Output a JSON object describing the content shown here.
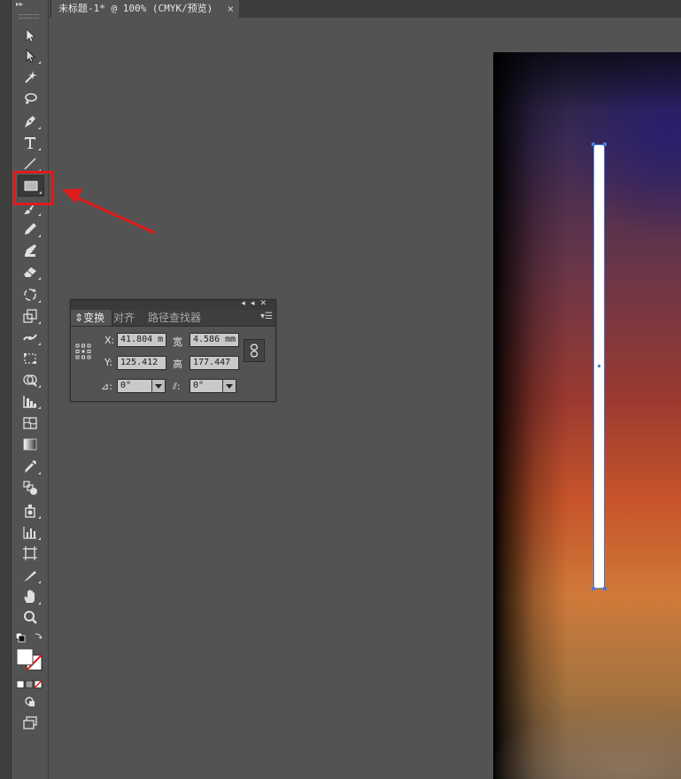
{
  "document_tab": {
    "title": "未标题-1* @ 100% (CMYK/预览)",
    "close": "×"
  },
  "toolbar": {
    "tools": [
      {
        "name": "selection-tool",
        "icon": "arrow-icon"
      },
      {
        "name": "direct-selection-tool",
        "icon": "white-arrow-icon"
      },
      {
        "name": "magic-wand-tool",
        "icon": "magic-wand-icon"
      },
      {
        "name": "lasso-tool",
        "icon": "lasso-icon"
      },
      {
        "name": "pen-tool",
        "icon": "pen-icon"
      },
      {
        "name": "type-tool",
        "icon": "type-icon",
        "label": "T"
      },
      {
        "name": "line-tool",
        "icon": "line-icon"
      },
      {
        "name": "rectangle-tool",
        "icon": "rectangle-icon"
      },
      {
        "name": "paintbrush-tool",
        "icon": "brush-icon"
      },
      {
        "name": "pencil-tool",
        "icon": "pencil-icon"
      },
      {
        "name": "blob-brush-tool",
        "icon": "blob-brush-icon"
      },
      {
        "name": "eraser-tool",
        "icon": "eraser-icon"
      },
      {
        "name": "rotate-tool",
        "icon": "rotate-icon"
      },
      {
        "name": "scale-tool",
        "icon": "scale-icon"
      },
      {
        "name": "width-tool",
        "icon": "width-icon"
      },
      {
        "name": "free-transform-tool",
        "icon": "free-transform-icon"
      },
      {
        "name": "shape-builder-tool",
        "icon": "shape-builder-icon"
      },
      {
        "name": "perspective-grid-tool",
        "icon": "perspective-grid-icon"
      },
      {
        "name": "mesh-tool",
        "icon": "mesh-icon"
      },
      {
        "name": "gradient-tool",
        "icon": "gradient-icon"
      },
      {
        "name": "eyedropper-tool",
        "icon": "eyedropper-icon"
      },
      {
        "name": "blend-tool",
        "icon": "blend-icon"
      },
      {
        "name": "symbol-sprayer-tool",
        "icon": "symbol-sprayer-icon"
      },
      {
        "name": "column-graph-tool",
        "icon": "column-graph-icon"
      },
      {
        "name": "artboard-tool",
        "icon": "artboard-icon"
      },
      {
        "name": "slice-tool",
        "icon": "slice-icon"
      },
      {
        "name": "hand-tool",
        "icon": "hand-icon"
      },
      {
        "name": "zoom-tool",
        "icon": "zoom-icon"
      }
    ],
    "selected_tool": "rectangle-tool"
  },
  "transform_panel": {
    "tabs": [
      "变换",
      "对齐",
      "路径查找器"
    ],
    "active_tab": "变换",
    "x_label": "X:",
    "x_value": "41.804 m",
    "y_label": "Y:",
    "y_value": "125.412",
    "w_label": "宽",
    "w_value": "4.586 mm",
    "h_label": "高",
    "h_value": "177.447",
    "rotate_label": "⊿:",
    "rotate_value": "0°",
    "shear_label": "⫽:",
    "shear_value": "0°"
  },
  "colors": {
    "annotation_red": "#e01b1b",
    "selection_blue": "#4a7bd8",
    "ui_gray": "#535353"
  }
}
